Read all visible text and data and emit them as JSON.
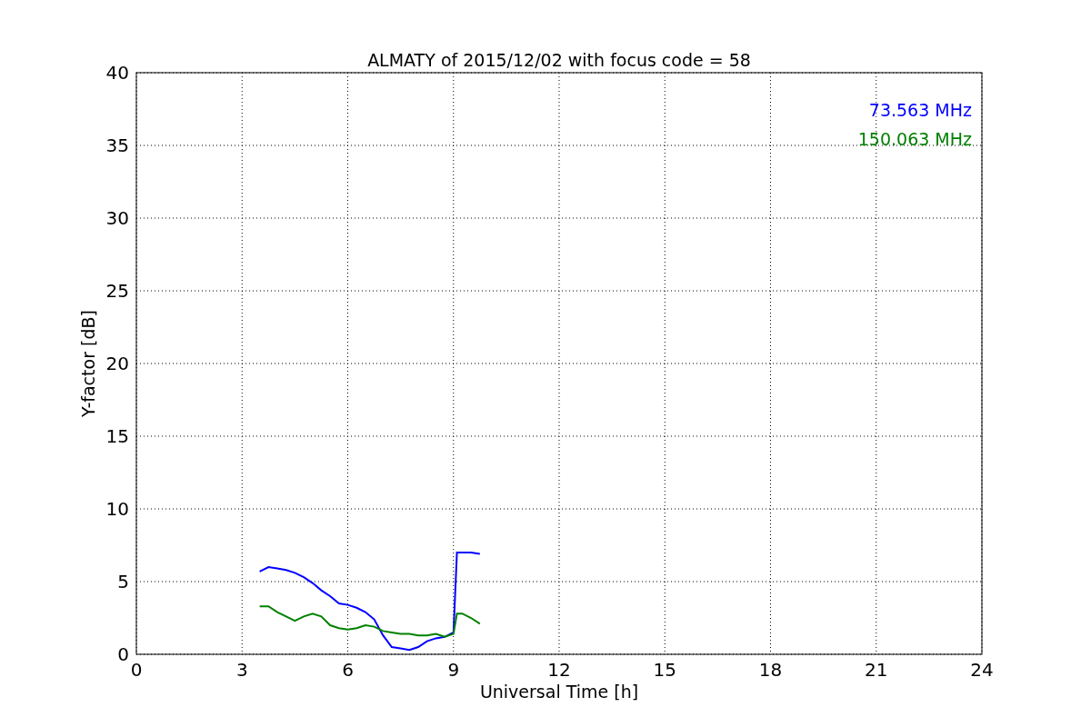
{
  "figure": {
    "chart_data": {
      "type": "line",
      "title": "ALMATY of 2015/12/02 with focus code = 58",
      "xlabel": "Universal Time [h]",
      "ylabel": "Y-factor [dB]",
      "x": [
        3.5,
        3.75,
        4.0,
        4.25,
        4.5,
        4.75,
        5.0,
        5.25,
        5.5,
        5.75,
        6.0,
        6.25,
        6.5,
        6.75,
        7.0,
        7.25,
        7.5,
        7.75,
        8.0,
        8.25,
        8.5,
        8.75,
        9.0,
        9.1,
        9.25,
        9.5,
        9.75
      ],
      "series": [
        {
          "name": "73.563 MHz",
          "color": "#0000ff",
          "values": [
            5.7,
            6.0,
            5.9,
            5.8,
            5.6,
            5.3,
            4.9,
            4.4,
            4.0,
            3.5,
            3.4,
            3.2,
            2.9,
            2.4,
            1.3,
            0.5,
            0.4,
            0.3,
            0.5,
            0.9,
            1.1,
            1.2,
            1.5,
            7.0,
            7.0,
            7.0,
            6.9
          ]
        },
        {
          "name": "150.063 MHz",
          "color": "#008000",
          "values": [
            3.3,
            3.3,
            2.9,
            2.6,
            2.3,
            2.6,
            2.8,
            2.6,
            2.0,
            1.8,
            1.7,
            1.8,
            2.0,
            1.9,
            1.6,
            1.5,
            1.4,
            1.4,
            1.3,
            1.3,
            1.4,
            1.2,
            1.4,
            2.8,
            2.8,
            2.5,
            2.1
          ]
        }
      ],
      "grid": true,
      "xlim": [
        0,
        24
      ],
      "ylim": [
        0,
        40
      ],
      "xticks": [
        0,
        3,
        6,
        9,
        12,
        15,
        18,
        21,
        24
      ],
      "yticks": [
        0,
        5,
        10,
        15,
        20,
        25,
        30,
        35,
        40
      ]
    }
  }
}
